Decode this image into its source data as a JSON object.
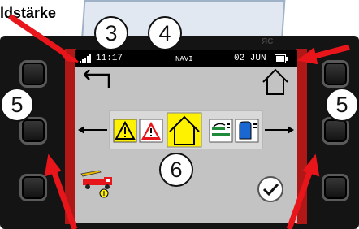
{
  "annotation": {
    "title": "ldstärke",
    "markers": [
      "3",
      "4",
      "5",
      "5",
      "6"
    ]
  },
  "status_bar": {
    "time": "11:17",
    "mode": "NAVI",
    "date": "02 JUN",
    "top_right_partial": "ЯС"
  },
  "icons": {
    "signal": "signal-bars-icon",
    "battery": "battery-icon",
    "back": "back-arrow-icon",
    "home": "home-icon",
    "warning_yellow": "warning-yellow-icon",
    "warning_red": "warning-red-icon",
    "home_selected": "home-selected-icon",
    "mower": "mower-settings-icon",
    "tank": "water-tank-icon",
    "truck": "truck-icon",
    "confirm": "checkmark-icon"
  },
  "colors": {
    "accent_red": "#e8151b",
    "selection_yellow": "#fff200",
    "screen_gray": "#c3c3c3"
  }
}
